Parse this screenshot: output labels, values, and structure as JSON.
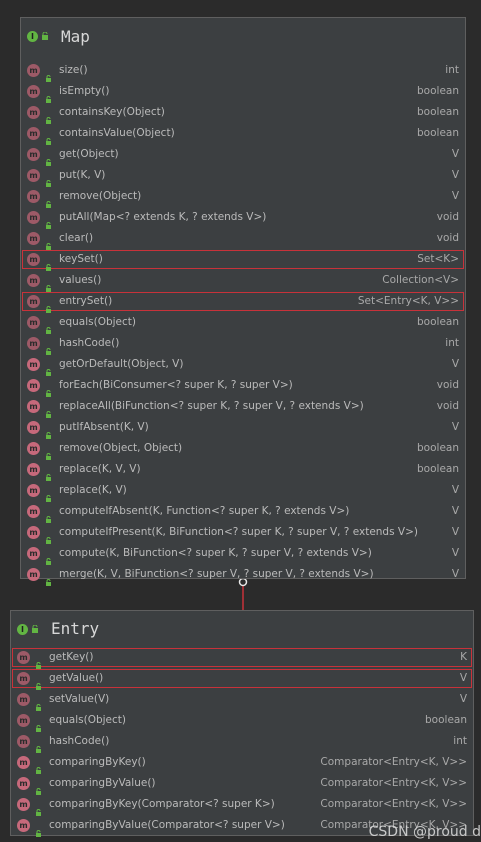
{
  "map": {
    "title": "Map",
    "icon": "interface-icon",
    "methods": [
      {
        "name": "size()",
        "type": "int",
        "highlight": false
      },
      {
        "name": "isEmpty()",
        "type": "boolean",
        "highlight": false
      },
      {
        "name": "containsKey(Object)",
        "type": "boolean",
        "highlight": false
      },
      {
        "name": "containsValue(Object)",
        "type": "boolean",
        "highlight": false
      },
      {
        "name": "get(Object)",
        "type": "V",
        "highlight": false
      },
      {
        "name": "put(K, V)",
        "type": "V",
        "highlight": false
      },
      {
        "name": "remove(Object)",
        "type": "V",
        "highlight": false
      },
      {
        "name": "putAll(Map<? extends K, ? extends V>)",
        "type": "void",
        "highlight": false
      },
      {
        "name": "clear()",
        "type": "void",
        "highlight": false
      },
      {
        "name": "keySet()",
        "type": "Set<K>",
        "highlight": true
      },
      {
        "name": "values()",
        "type": "Collection<V>",
        "highlight": false
      },
      {
        "name": "entrySet()",
        "type": "Set<Entry<K, V>>",
        "highlight": true
      },
      {
        "name": "equals(Object)",
        "type": "boolean",
        "highlight": false
      },
      {
        "name": "hashCode()",
        "type": "int",
        "highlight": false
      },
      {
        "name": "getOrDefault(Object, V)",
        "type": "V",
        "highlight": false
      },
      {
        "name": "forEach(BiConsumer<? super K, ? super V>)",
        "type": "void",
        "highlight": false
      },
      {
        "name": "replaceAll(BiFunction<? super K, ? super V, ? extends V>)",
        "type": "void",
        "highlight": false
      },
      {
        "name": "putIfAbsent(K, V)",
        "type": "V",
        "highlight": false
      },
      {
        "name": "remove(Object, Object)",
        "type": "boolean",
        "highlight": false
      },
      {
        "name": "replace(K, V, V)",
        "type": "boolean",
        "highlight": false
      },
      {
        "name": "replace(K, V)",
        "type": "V",
        "highlight": false
      },
      {
        "name": "computeIfAbsent(K, Function<? super K, ? extends V>)",
        "type": "V",
        "highlight": false
      },
      {
        "name": "computeIfPresent(K, BiFunction<? super K, ? super V, ? extends V>)",
        "type": "V",
        "highlight": false
      },
      {
        "name": "compute(K, BiFunction<? super K, ? super V, ? extends V>)",
        "type": "V",
        "highlight": false
      },
      {
        "name": "merge(K, V, BiFunction<? super V, ? super V, ? extends V>)",
        "type": "V",
        "highlight": false
      }
    ]
  },
  "entry": {
    "title": "Entry",
    "icon": "inner-interface-icon",
    "methods": [
      {
        "name": "getKey()",
        "type": "K",
        "highlight": true
      },
      {
        "name": "getValue()",
        "type": "V",
        "highlight": true
      },
      {
        "name": "setValue(V)",
        "type": "V",
        "highlight": false
      },
      {
        "name": "equals(Object)",
        "type": "boolean",
        "highlight": false
      },
      {
        "name": "hashCode()",
        "type": "int",
        "highlight": false
      },
      {
        "name": "comparingByKey()",
        "type": "Comparator<Entry<K, V>>",
        "highlight": false
      },
      {
        "name": "comparingByValue()",
        "type": "Comparator<Entry<K, V>>",
        "highlight": false
      },
      {
        "name": "comparingByKey(Comparator<? super K>)",
        "type": "Comparator<Entry<K, V>>",
        "highlight": false
      },
      {
        "name": "comparingByValue(Comparator<? super V>)",
        "type": "Comparator<Entry<K, V>>",
        "highlight": false
      }
    ]
  },
  "colors": {
    "background": "#2b2b2b",
    "box": "#3c3f41",
    "highlight_border": "#c8323a",
    "connector": "#c8323a"
  },
  "watermark": "CSDN @proud d"
}
